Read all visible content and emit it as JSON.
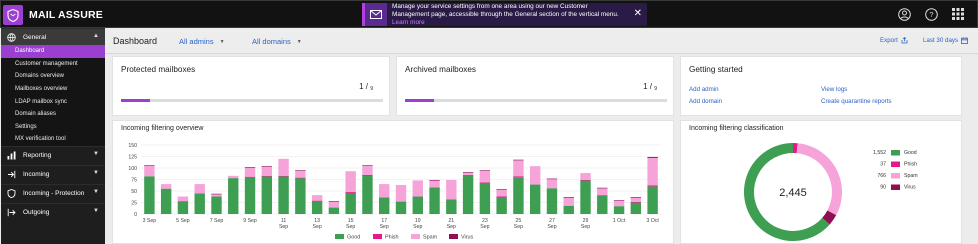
{
  "app": {
    "brand": "MAIL ASSURE",
    "banner": {
      "text": "Manage your service settings from one area using our new Customer Management page, accessible through the General section of the vertical menu.",
      "link": "Learn more",
      "close": "✕"
    },
    "top_icons": [
      "user-icon",
      "help-icon",
      "apps-grid-icon"
    ]
  },
  "sidebar": {
    "sections": [
      {
        "label": "General",
        "icon": "globe-icon",
        "expanded": true
      },
      {
        "label": "Reporting",
        "icon": "bar-chart-icon"
      },
      {
        "label": "Incoming",
        "icon": "incoming-icon"
      },
      {
        "label": "Incoming - Protection",
        "icon": "shield-icon"
      },
      {
        "label": "Outgoing",
        "icon": "outgoing-icon"
      }
    ],
    "general_items": [
      "Dashboard",
      "Customer management",
      "Domains overview",
      "Mailboxes overview",
      "LDAP mailbox sync",
      "Domain aliases",
      "Settings",
      "MX verification tool"
    ]
  },
  "header": {
    "title": "Dashboard",
    "admins_filter": "All admins",
    "domains_filter": "All domains",
    "export": "Export",
    "range": "Last 30 days"
  },
  "protected": {
    "title": "Protected mailboxes",
    "count": "1",
    "total": "9",
    "fraction": 0.11
  },
  "archived": {
    "title": "Archived mailboxes",
    "count": "1",
    "total": "9",
    "fraction": 0.11
  },
  "getting_started": {
    "title": "Getting started",
    "links": [
      "Add admin",
      "Add domain",
      "View logs",
      "Create quarantine reports"
    ]
  },
  "overview": {
    "title": "Incoming filtering overview"
  },
  "classification": {
    "title": "Incoming filtering classification"
  },
  "colors": {
    "good": "#3e9e52",
    "phish": "#e8178a",
    "spam": "#f5a3d9",
    "virus": "#8e0f53",
    "accent": "#9b3fd1"
  },
  "chart_data": [
    {
      "type": "bar",
      "stacked": true,
      "title": "Incoming filtering overview",
      "y_ticks": [
        0,
        25,
        50,
        75,
        100,
        125,
        150
      ],
      "ylim": [
        0,
        150
      ],
      "x_tick_labels": [
        "3 Sep",
        "5 Sep",
        "7 Sep",
        "9 Sep",
        "11 Sep",
        "13 Sep",
        "15 Sep",
        "17 Sep",
        "19 Sep",
        "21 Sep",
        "23 Sep",
        "25 Sep",
        "27 Sep",
        "29 Sep",
        "1 Oct",
        "3 Oct"
      ],
      "categories": [
        "3 Sep",
        "4 Sep",
        "5 Sep",
        "6 Sep",
        "7 Sep",
        "8 Sep",
        "9 Sep",
        "10 Sep",
        "11 Sep",
        "12 Sep",
        "13 Sep",
        "14 Sep",
        "15 Sep",
        "16 Sep",
        "17 Sep",
        "18 Sep",
        "19 Sep",
        "20 Sep",
        "21 Sep",
        "22 Sep",
        "23 Sep",
        "24 Sep",
        "25 Sep",
        "26 Sep",
        "27 Sep",
        "28 Sep",
        "29 Sep",
        "30 Sep",
        "1 Oct",
        "2 Oct",
        "3 Oct"
      ],
      "series": [
        {
          "name": "Good",
          "color": "#3e9e52",
          "values": [
            82,
            55,
            28,
            45,
            38,
            78,
            80,
            82,
            82,
            78,
            28,
            14,
            46,
            84,
            36,
            27,
            38,
            58,
            32,
            85,
            68,
            37,
            80,
            64,
            56,
            18,
            73,
            40,
            17,
            25,
            60
          ]
        },
        {
          "name": "Phish",
          "color": "#e8178a",
          "values": [
            0,
            0,
            0,
            0,
            0,
            0,
            1,
            1,
            1,
            1,
            1,
            0,
            2,
            1,
            0,
            0,
            0,
            0,
            0,
            0,
            1,
            1,
            2,
            0,
            0,
            0,
            1,
            1,
            0,
            1,
            2
          ]
        },
        {
          "name": "Spam",
          "color": "#f5a3d9",
          "values": [
            23,
            10,
            10,
            20,
            5,
            5,
            20,
            20,
            37,
            15,
            12,
            13,
            45,
            20,
            29,
            36,
            35,
            15,
            42,
            5,
            25,
            15,
            35,
            40,
            20,
            18,
            15,
            15,
            12,
            10,
            60
          ]
        },
        {
          "name": "Virus",
          "color": "#8e0f53",
          "values": [
            1,
            0,
            0,
            0,
            1,
            0,
            1,
            1,
            0,
            1,
            0,
            1,
            0,
            1,
            0,
            0,
            0,
            1,
            0,
            1,
            1,
            1,
            1,
            0,
            1,
            1,
            0,
            1,
            1,
            1,
            2
          ]
        }
      ],
      "legend": [
        "Good",
        "Phish",
        "Spam",
        "Virus"
      ],
      "legend_position": "bottom",
      "grid": true
    },
    {
      "type": "pie",
      "donut": true,
      "title": "Incoming filtering classification",
      "total_label": "2,445",
      "labels": [
        "Good",
        "Phish",
        "Spam",
        "Virus"
      ],
      "values": [
        1552,
        37,
        766,
        90
      ],
      "value_labels": [
        "1,552",
        "37",
        "766",
        "90"
      ],
      "colors": [
        "#3e9e52",
        "#e8178a",
        "#f5a3d9",
        "#8e0f53"
      ],
      "legend_position": "right"
    }
  ]
}
